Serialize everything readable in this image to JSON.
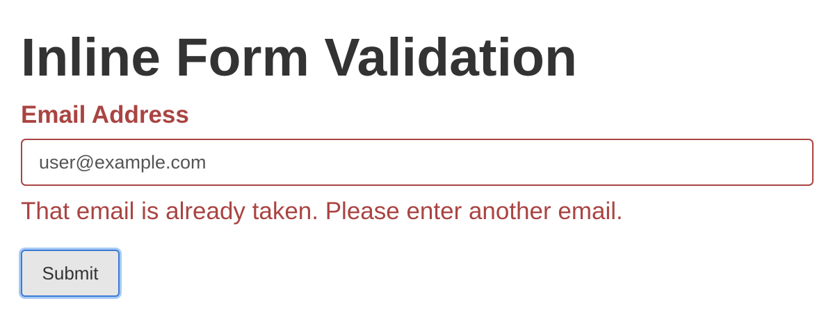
{
  "page": {
    "title": "Inline Form Validation"
  },
  "form": {
    "email_label": "Email Address",
    "email_value": "user@example.com",
    "error_message": "That email is already taken. Please enter another email.",
    "submit_label": "Submit",
    "error_color": "#a94442",
    "focus_color": "#3b7bd4"
  }
}
